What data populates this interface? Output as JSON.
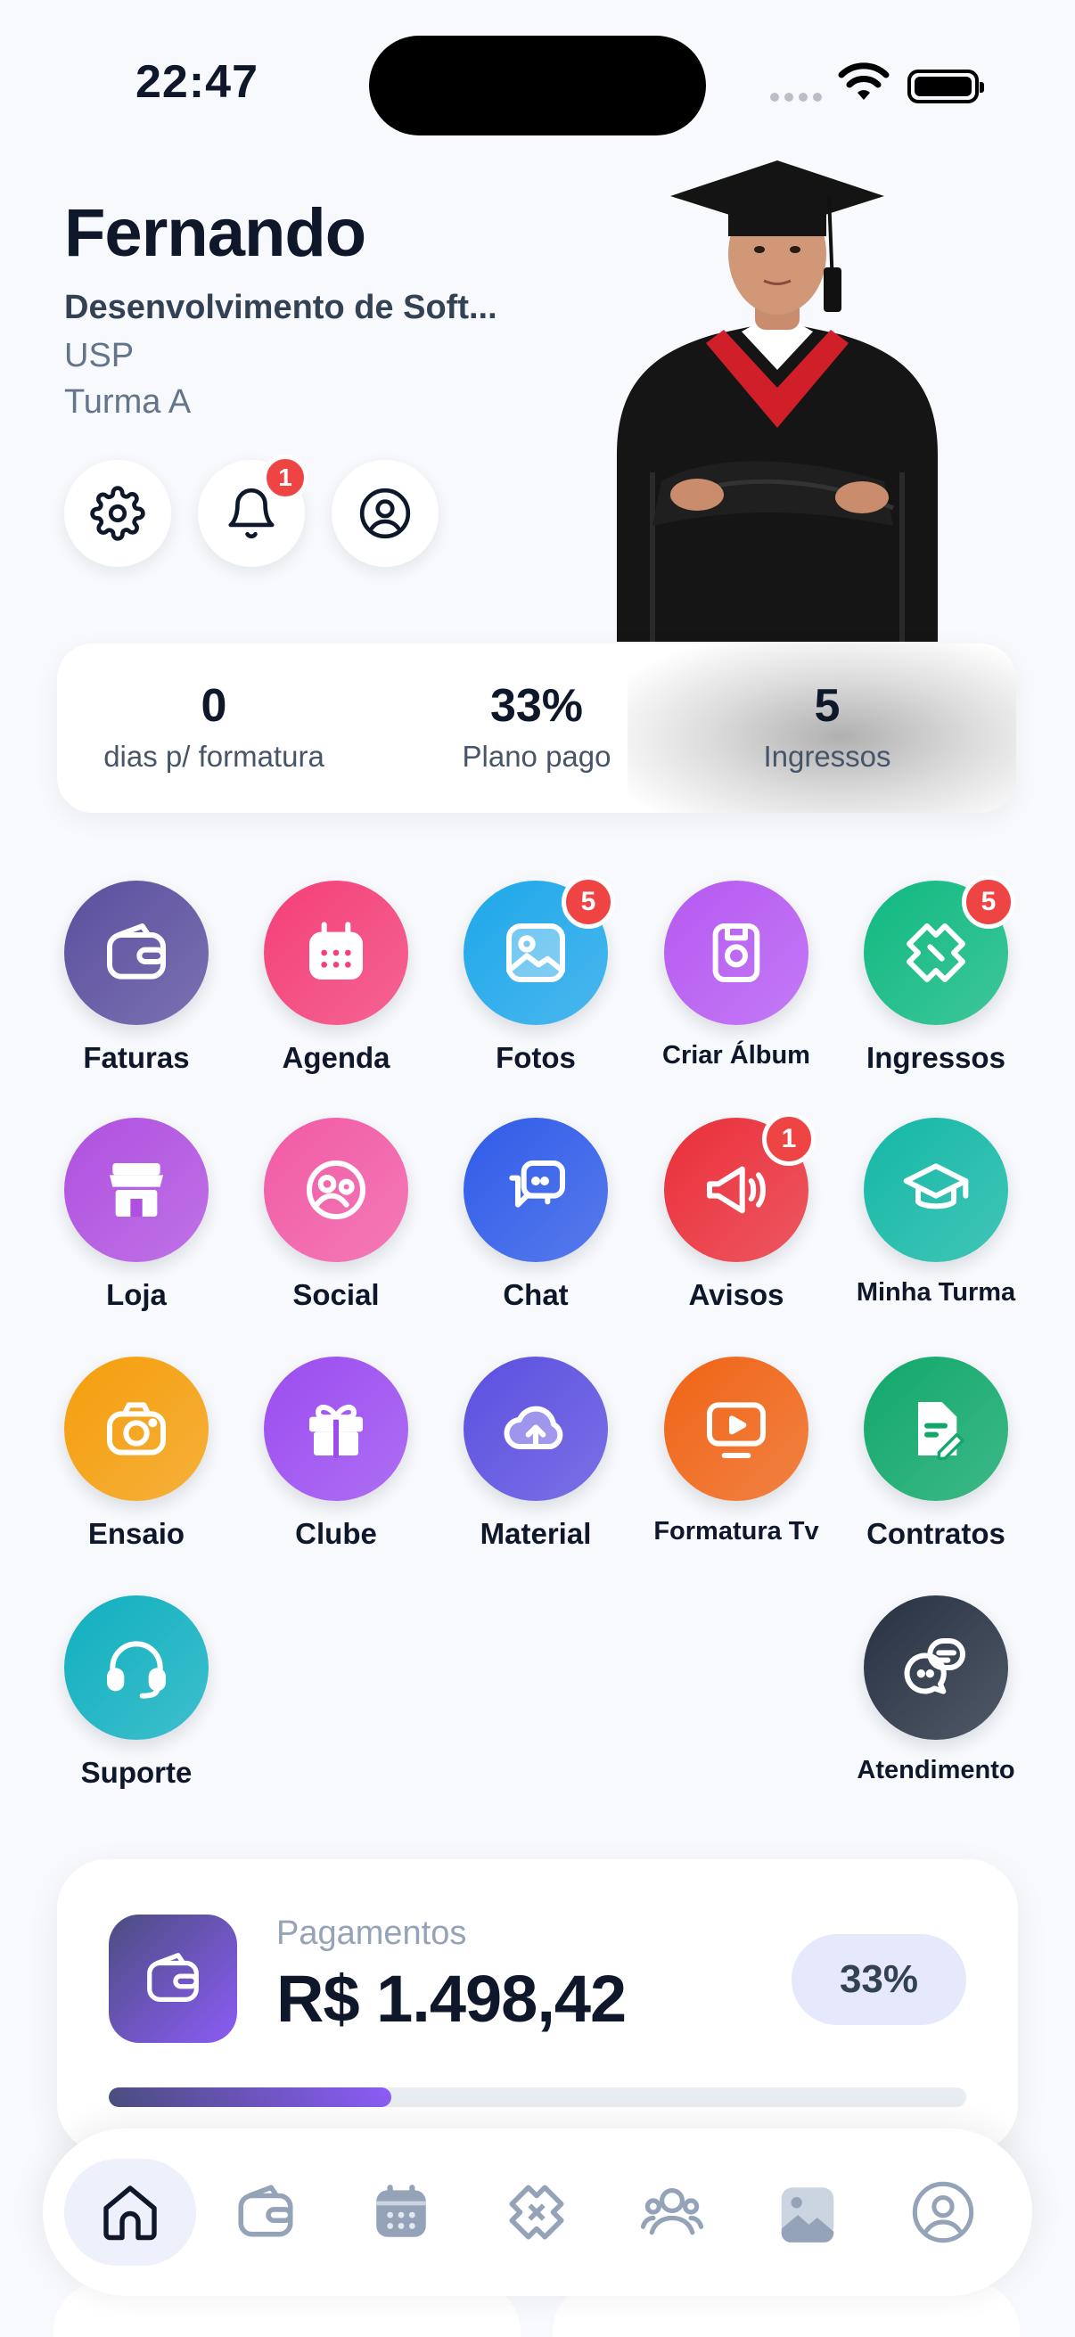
{
  "status_bar": {
    "time": "22:47"
  },
  "profile": {
    "name": "Fernando",
    "course": "Desenvolvimento de Soft...",
    "school": "USP",
    "class": "Turma A",
    "notifications_badge": "1"
  },
  "stats": [
    {
      "value": "0",
      "label": "dias p/ formatura"
    },
    {
      "value": "33%",
      "label": "Plano pago"
    },
    {
      "value": "5",
      "label": "Ingressos"
    }
  ],
  "menu": [
    {
      "label": "Faturas",
      "icon": "wallet-icon",
      "color": "#5b4f9e",
      "badge": ""
    },
    {
      "label": "Agenda",
      "icon": "calendar-icon",
      "color": "#f43f78",
      "badge": ""
    },
    {
      "label": "Fotos",
      "icon": "image-icon",
      "color": "#1ea7ea",
      "badge": "5"
    },
    {
      "label": "Criar Álbum",
      "icon": "album-icon",
      "color": "#b659f2",
      "badge": ""
    },
    {
      "label": "Ingressos",
      "icon": "ticket-icon",
      "color": "#10b981",
      "badge": "5"
    },
    {
      "label": "Loja",
      "icon": "store-icon",
      "color": "#b050e0",
      "badge": ""
    },
    {
      "label": "Social",
      "icon": "social-icon",
      "color": "#f25aa5",
      "badge": ""
    },
    {
      "label": "Chat",
      "icon": "chat-icon",
      "color": "#2f5be8",
      "badge": ""
    },
    {
      "label": "Avisos",
      "icon": "megaphone-icon",
      "color": "#ea2f3a",
      "badge": "1"
    },
    {
      "label": "Minha Turma",
      "icon": "graduation-cap-icon",
      "color": "#14b8a6",
      "badge": ""
    },
    {
      "label": "Ensaio",
      "icon": "camera-icon",
      "color": "#f59e0b",
      "badge": ""
    },
    {
      "label": "Clube",
      "icon": "gift-icon",
      "color": "#9b4cf0",
      "badge": ""
    },
    {
      "label": "Material",
      "icon": "cloud-upload-icon",
      "color": "#5b4fe0",
      "badge": ""
    },
    {
      "label": "Formatura Tv",
      "icon": "tv-play-icon",
      "color": "#f06415",
      "badge": ""
    },
    {
      "label": "Contratos",
      "icon": "contract-icon",
      "color": "#10a86a",
      "badge": ""
    },
    {
      "label": "Suporte",
      "icon": "headset-icon",
      "color": "#10b0c0",
      "badge": ""
    },
    {
      "label": "Atendimento",
      "icon": "chat-bubbles-icon",
      "color": "#273142",
      "badge": ""
    }
  ],
  "payments": {
    "label": "Pagamentos",
    "value": "R$ 1.498,42",
    "percent": "33%",
    "progress": 0.33
  },
  "tabbar": [
    "home-icon",
    "wallet-icon",
    "calendar-icon",
    "ticket-icon",
    "people-icon",
    "gallery-icon",
    "profile-icon"
  ]
}
